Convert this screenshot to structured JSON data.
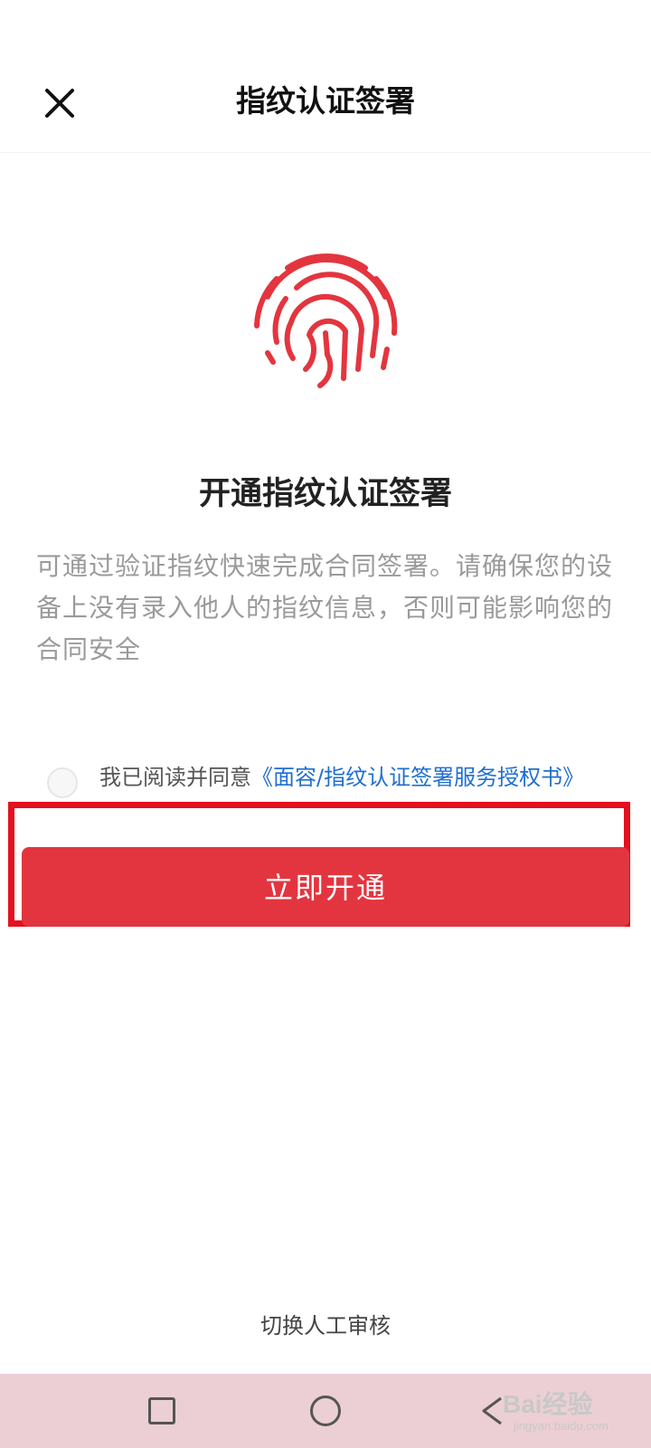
{
  "header": {
    "title": "指纹认证签署",
    "close_icon": "close-icon"
  },
  "main": {
    "icon": "fingerprint-icon",
    "icon_color": "#e3353f",
    "heading": "开通指纹认证签署",
    "description": "可通过验证指纹快速完成合同签署。请确保您的设备上没有录入他人的指纹信息，否则可能影响您的合同安全"
  },
  "agreement": {
    "checked": false,
    "prefix": "我已阅读并同意",
    "link": "《面容/指纹认证签署服务授权书》"
  },
  "primary_button": {
    "label": "立即开通",
    "color": "#e3353f"
  },
  "switch_link": "切换人工审核",
  "system_nav": {
    "items": [
      "recent-apps-icon",
      "home-icon",
      "back-icon"
    ],
    "background": "#eccfd4"
  },
  "watermark": {
    "main": "Bai经验",
    "sub": "jingyan.baidu.com"
  }
}
